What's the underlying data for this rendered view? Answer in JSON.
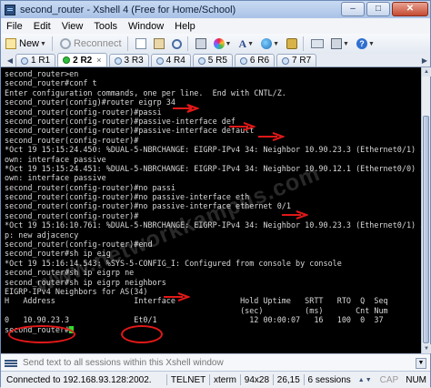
{
  "window": {
    "title": "second_router - Xshell 4 (Free for Home/School)",
    "controls": {
      "minimize": "‒",
      "maximize": "□",
      "close": "✕"
    }
  },
  "menu": [
    "File",
    "Edit",
    "View",
    "Tools",
    "Window",
    "Help"
  ],
  "toolbar": {
    "new_label": "New",
    "reconnect_label": "Reconnect",
    "font_glyph": "A"
  },
  "tabs": [
    {
      "label": "1 R1",
      "active": false
    },
    {
      "label": "2 R2",
      "active": true
    },
    {
      "label": "3 R3",
      "active": false
    },
    {
      "label": "4 R4",
      "active": false
    },
    {
      "label": "5 R5",
      "active": false
    },
    {
      "label": "6 R6",
      "active": false
    },
    {
      "label": "7 R7",
      "active": false
    }
  ],
  "terminal": {
    "lines": [
      "second_router>en",
      "second_router#conf t",
      "Enter configuration commands, one per line.  End with CNTL/Z.",
      "second_router(config)#router eigrp 34",
      "second_router(config-router)#passi",
      "second_router(config-router)#passive-interface def",
      "second_router(config-router)#passive-interface default",
      "second_router(config-router)#",
      "*Oct 19 15:15:24.450: %DUAL-5-NBRCHANGE: EIGRP-IPv4 34: Neighbor 10.90.23.3 (Ethernet0/1) is d",
      "own: interface passive",
      "*Oct 19 15:15:24.451: %DUAL-5-NBRCHANGE: EIGRP-IPv4 34: Neighbor 10.90.12.1 (Ethernet0/0) is d",
      "own: interface passive",
      "second_router(config-router)#no passi",
      "second_router(config-router)#no passive-interface eth",
      "second_router(config-router)#no passive-interface ethernet 0/1",
      "second_router(config-router)#",
      "*Oct 19 15:16:10.761: %DUAL-5-NBRCHANGE: EIGRP-IPv4 34: Neighbor 10.90.23.3 (Ethernet0/1) is u",
      "p: new adjacency",
      "second_router(config-router)#end",
      "second_router#sh ip eig",
      "*Oct 19 15:16:14.543: %SYS-5-CONFIG_I: Configured from console by console",
      "second_router#sh ip eigrp ne",
      "second_router#sh ip eigrp neighbors",
      "EIGRP-IPv4 Neighbors for AS(34)",
      "H   Address                 Interface              Hold Uptime   SRTT   RTO  Q  Seq",
      "                                                   (sec)         (ms)       Cnt Num",
      "0   10.90.23.3              Et0/1                    12 00:00:07   16   100  0  37",
      "second_router#"
    ],
    "cursor_color": "#2fdc2f"
  },
  "watermark": "www.networkkampus.com",
  "annotation_color": "#e01818",
  "send_bar": {
    "placeholder": "Send text to all sessions within this Xshell window"
  },
  "status_bar": {
    "connection": "Connected to 192.168.93.128:2002.",
    "protocol": "TELNET",
    "terminal_type": "xterm",
    "size": "94x28",
    "cursor_pos": "26,15",
    "sessions": "6 sessions",
    "caps": "CAP",
    "num": "NUM"
  }
}
